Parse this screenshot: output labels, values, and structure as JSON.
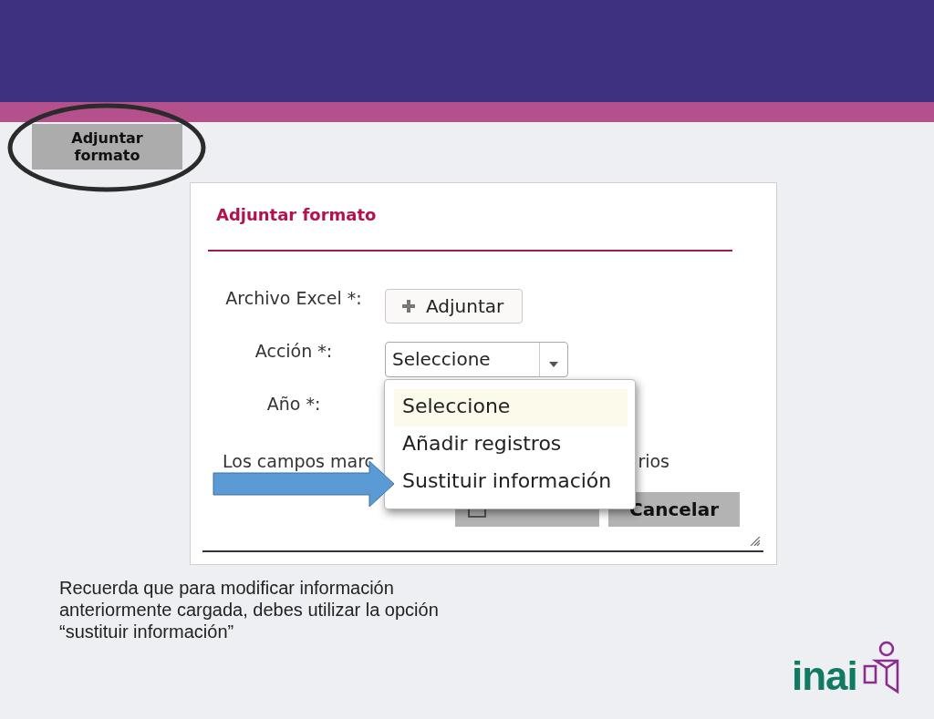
{
  "slide_button": {
    "label": "Adjuntar formato"
  },
  "dialog": {
    "title": "Adjuntar formato",
    "fields": [
      {
        "label": "Archivo Excel *:",
        "kind": "upload",
        "button": "Adjuntar"
      },
      {
        "label": "Acción *:",
        "kind": "select",
        "value": "Seleccione"
      },
      {
        "label": "Año *:",
        "kind": "empty"
      }
    ],
    "note_parts": [
      "Los campos marc",
      "rios"
    ],
    "buttons": [
      {
        "kind": "accept"
      },
      {
        "label": "Cancelar",
        "kind": "cancel"
      }
    ]
  },
  "dropdown": {
    "options": [
      {
        "label": "Seleccione",
        "selected": true
      },
      {
        "label": "Añadir registros",
        "selected": false
      },
      {
        "label": "Sustituir información",
        "selected": false
      }
    ]
  },
  "caption": "Recuerda que para modificar información anteriormente cargada, debes utilizar la opción “sustituir información”",
  "logo": {
    "text": "inai"
  }
}
